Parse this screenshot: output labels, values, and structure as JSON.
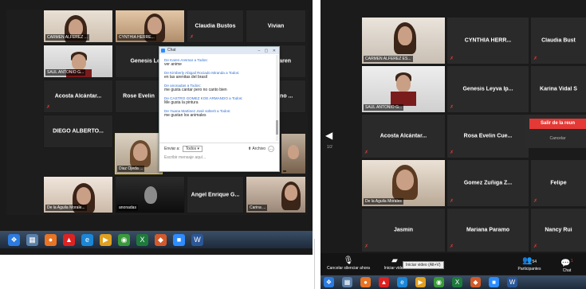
{
  "left": {
    "tiles": [
      {
        "name": "CARMEN ALFEREZ ...",
        "video": true
      },
      {
        "name": "CYNTHIA HERRE...",
        "video": true
      },
      {
        "name": "Claudia Bustos",
        "video": false
      },
      {
        "name": "Vivian",
        "video": false
      },
      {
        "name": "SAUL ANTONIO G...",
        "video": true
      },
      {
        "name": "Genesis Leyva",
        "video": false
      },
      {
        "name": "...onaKaren",
        "video": false
      },
      {
        "name": "Acosta Alcántar...",
        "video": false
      },
      {
        "name": "Rose Evelin",
        "video": false
      },
      {
        "name": "...Emiliano ...",
        "video": false
      },
      {
        "name": "DIEGO ALBERTO...",
        "video": false
      },
      {
        "name": "Diaz Ojeda ...",
        "video": true
      },
      {
        "name": "",
        "video": true
      },
      {
        "name": "De la Aguila Morale...",
        "video": true
      },
      {
        "name": "anonadas",
        "video": true
      },
      {
        "name": "Angel Enrique G...",
        "video": false
      },
      {
        "name": "Carina ...",
        "video": true
      }
    ],
    "chat": {
      "title": "Chat",
      "messages": [
        {
          "from": "De Karen Ansmar a Todos:",
          "text": "ver anime"
        },
        {
          "from": "De Kimberly Abigail Rociado Miranda a Todos:",
          "text": "en las arenitas del brasil"
        },
        {
          "from": "De anonadas a Todos:",
          "text": "me gusta cantar pero no canto bien"
        },
        {
          "from": "De CASTRO GOMEZ KOE ARMANDO a Todos:",
          "text": "Me gusta la pintura"
        },
        {
          "from": "De Yuana Martinez José solterit a Todos:",
          "text": "me gustan los animales"
        }
      ],
      "send_to_label": "Enviar a:",
      "send_to_value": "Todos",
      "file_label": "Archivo",
      "more": "...",
      "input_placeholder": "Escribir mensaje aquí..."
    }
  },
  "right": {
    "tiles": [
      {
        "name": "CARMEN ALFEREZ ES...",
        "video": true
      },
      {
        "name": "CYNTHIA HERR...",
        "video": false
      },
      {
        "name": "Claudia Bust",
        "video": false
      },
      {
        "name": "SAUL ANTONIO G...",
        "video": true
      },
      {
        "name": "Genesis Leyva Ip...",
        "video": false
      },
      {
        "name": "Karina Vidal S",
        "video": false
      },
      {
        "name": "Acosta Alcántar...",
        "video": false
      },
      {
        "name": "Rosa Evelin Cue...",
        "video": false
      },
      {
        "name": "De la Aguila Morales",
        "video": true
      },
      {
        "name": "Gomez Zuñiga Z...",
        "video": false
      },
      {
        "name": "Felipe",
        "video": false
      },
      {
        "name": "Jasmin",
        "video": false
      },
      {
        "name": "Mariana Paramo",
        "video": false
      },
      {
        "name": "Nancy Rui",
        "video": false
      }
    ],
    "page_indicator": "1/2",
    "leave": {
      "button": "Salir de la reun",
      "cancel": "Cancelar"
    },
    "toolbar": {
      "mute_all": "Cancelar silenciar ahora",
      "start_video": "Iniciar video",
      "tooltip": "Iniciar video (Alt+V)",
      "participants": "Participantes",
      "participants_count": "54",
      "chat": "Chat",
      "chat_badge": "1"
    }
  },
  "colors": {
    "active_speaker": "#e3d04b",
    "leave": "#e53935",
    "chat_link": "#2d6fd6"
  }
}
